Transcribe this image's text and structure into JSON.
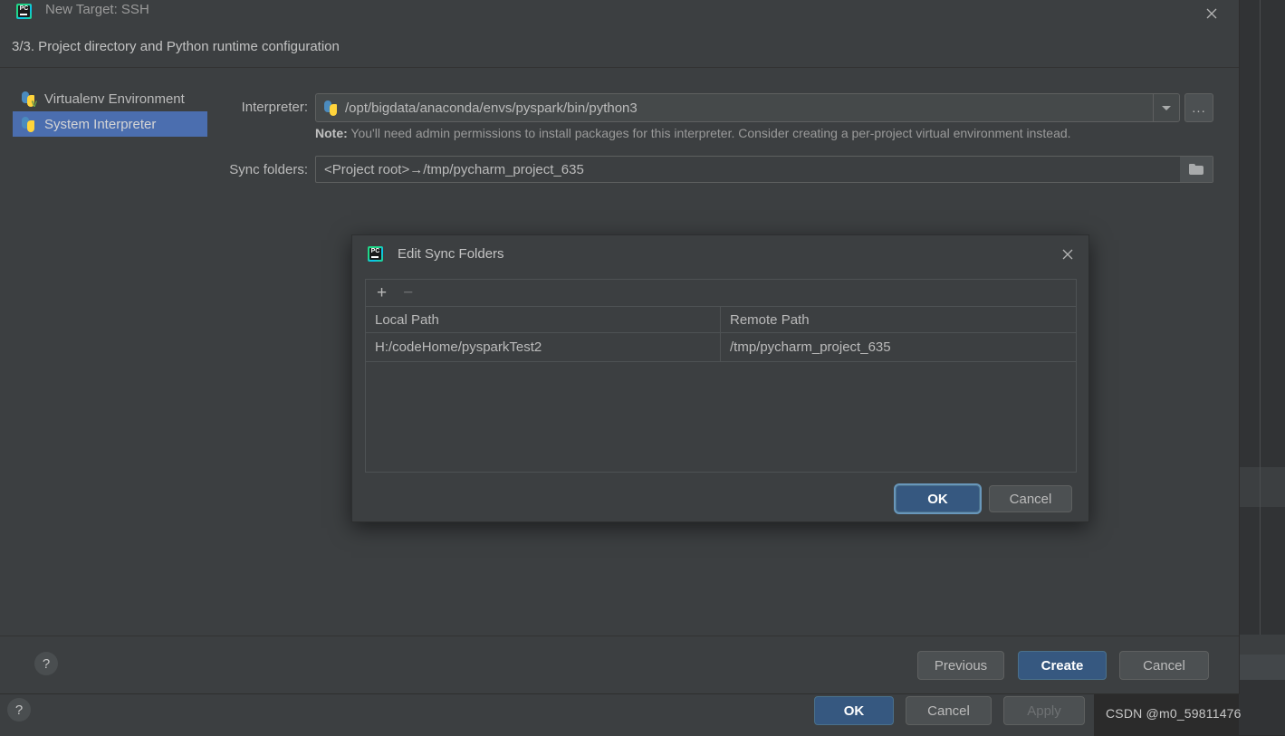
{
  "background": {
    "watermark": "CSDN @m0_59811476",
    "parent_window": {
      "help_label": "?",
      "buttons": [
        {
          "label": "OK",
          "style": "primary",
          "enabled": true
        },
        {
          "label": "Cancel",
          "style": "default",
          "enabled": true
        },
        {
          "label": "Apply",
          "style": "default",
          "enabled": false
        }
      ]
    }
  },
  "wizard": {
    "icon": "pycharm-icon",
    "title": "New Target: SSH",
    "close_icon": "close-icon",
    "subtitle": "3/3. Project directory and Python runtime configuration",
    "env_list": [
      {
        "label": "Virtualenv Environment",
        "icon": "python-venv-icon",
        "selected": false
      },
      {
        "label": "System Interpreter",
        "icon": "python-icon",
        "selected": true
      }
    ],
    "form": {
      "interpreter_label": "Interpreter:",
      "interpreter_value": "/opt/bigdata/anaconda/envs/pyspark/bin/python3",
      "interpreter_icon": "python-icon",
      "dropdown_icon": "chevron-down-icon",
      "browse_label": "...",
      "note_prefix": "Note:",
      "note_text": " You'll need admin permissions to install packages for this interpreter. Consider creating a per-project virtual environment instead.",
      "sync_label": "Sync folders:",
      "sync_value": "<Project root>→/tmp/pycharm_project_635",
      "sync_browse_icon": "folder-icon"
    },
    "footer": {
      "help_label": "?",
      "buttons": [
        {
          "label": "Previous",
          "style": "default"
        },
        {
          "label": "Create",
          "style": "primary"
        },
        {
          "label": "Cancel",
          "style": "default"
        }
      ]
    }
  },
  "modal": {
    "icon": "pycharm-icon",
    "title": "Edit Sync Folders",
    "close_icon": "close-icon",
    "toolbar": {
      "add_label": "+",
      "remove_label": "−"
    },
    "table": {
      "columns": [
        "Local Path",
        "Remote Path"
      ],
      "rows": [
        {
          "local": "H:/codeHome/pysparkTest2",
          "remote": "/tmp/pycharm_project_635"
        }
      ]
    },
    "buttons": [
      {
        "label": "OK",
        "style": "primary",
        "focused": true
      },
      {
        "label": "Cancel",
        "style": "default",
        "focused": false
      }
    ]
  },
  "colors": {
    "window_bg": "#3c3f41",
    "ide_bg": "#2b2b2b",
    "accent_blue": "#365880",
    "selection_blue": "#4b6eaf",
    "focus_ring": "#6897bb",
    "text": "#bbbbbb",
    "text_dim": "#9a9a9a"
  }
}
